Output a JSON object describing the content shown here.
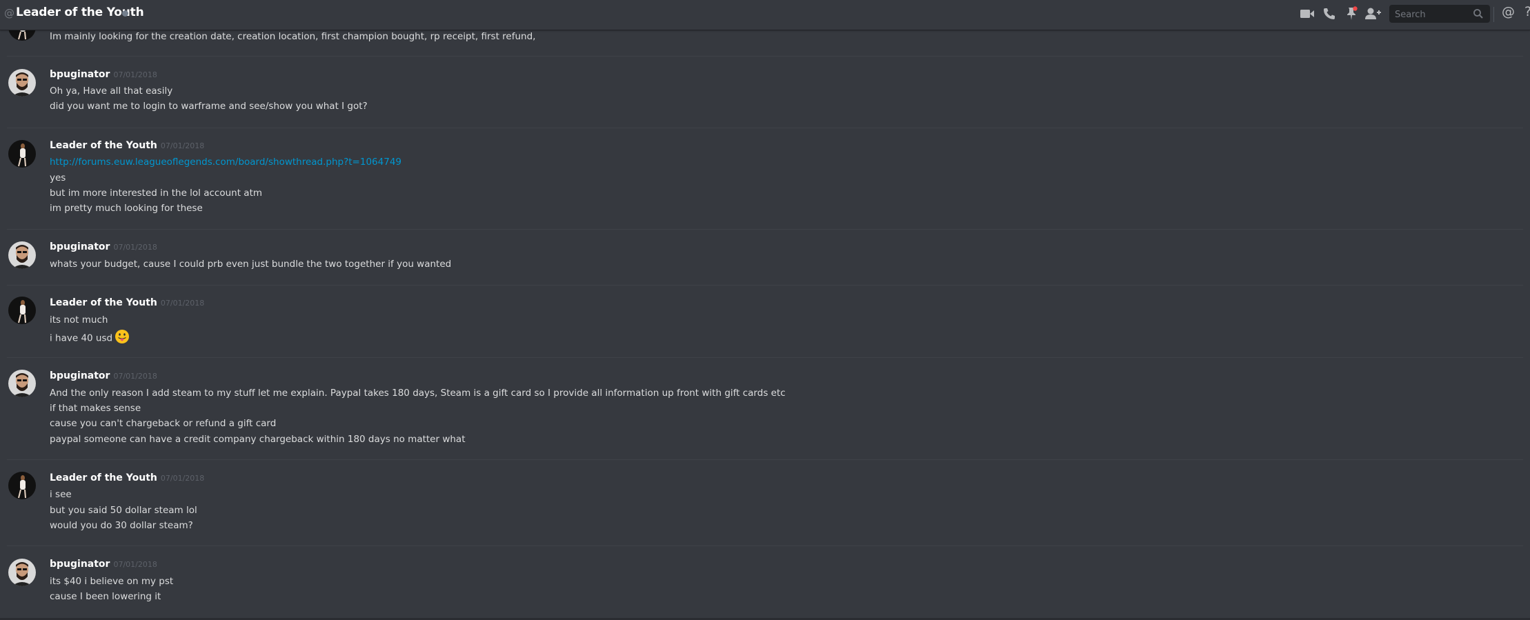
{
  "header": {
    "title": "Leader of the Youth",
    "search_placeholder": "Search",
    "icons": [
      "video-call-icon",
      "voice-call-icon",
      "pinned-messages-icon",
      "add-friend-icon",
      "search-icon",
      "mentions-icon",
      "help-icon"
    ]
  },
  "messages": [
    {
      "author": "",
      "timestamp": "",
      "lines": [
        "Im mainly looking for the creation date, creation location, first champion bought, rp receipt, first refund,"
      ]
    },
    {
      "author": "bpuginator",
      "timestamp": "07/01/2018",
      "lines": [
        "Oh ya, Have all that easily",
        "did you want me to login to warframe and see/show you what I got?"
      ]
    },
    {
      "author": "Leader of the Youth",
      "timestamp": "07/01/2018",
      "link": "http://forums.euw.leagueoflegends.com/board/showthread.php?t=1064749",
      "lines": [
        "yes",
        "but im more interested in the lol account atm",
        "im pretty much looking for these"
      ]
    },
    {
      "author": "bpuginator",
      "timestamp": "07/01/2018",
      "lines": [
        "whats your budget, cause I could prb even just bundle the two together if you wanted"
      ]
    },
    {
      "author": "Leader of the Youth",
      "timestamp": "07/01/2018",
      "lines": [
        "its not much",
        "i have 40 usd"
      ]
    },
    {
      "author": "bpuginator",
      "timestamp": "07/01/2018",
      "lines": [
        "And the only reason I add steam to my stuff let me explain. Paypal takes 180 days, Steam is a gift card so I provide all information up front with gift cards etc",
        "if that makes sense",
        "cause you can't chargeback or refund a gift card",
        "paypal someone can have a credit company chargeback within 180 days no matter what"
      ]
    },
    {
      "author": "Leader of the Youth",
      "timestamp": "07/01/2018",
      "lines": [
        "i see",
        "but you said 50 dollar steam lol",
        "would you do 30 dollar steam?"
      ]
    },
    {
      "author": "bpuginator",
      "timestamp": "07/01/2018",
      "lines": [
        "its $40 i believe on my pst",
        "cause I been lowering it"
      ]
    }
  ]
}
